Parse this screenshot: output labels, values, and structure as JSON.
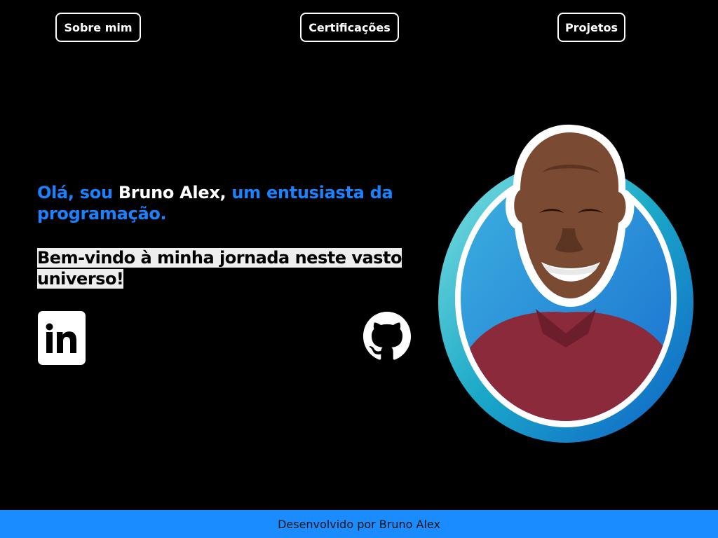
{
  "nav": {
    "about_label": "Sobre mim",
    "certs_label": "Certificações",
    "projects_label": "Projetos"
  },
  "hero": {
    "greeting_prefix": "Olá, sou ",
    "name": "Bruno Alex,",
    "greeting_suffix": " um entusiasta da programação.",
    "welcome": "Bem-vindo à minha jornada neste vasto universo!"
  },
  "social": {
    "linkedin_icon": "linkedin-icon",
    "github_icon": "github-icon"
  },
  "footer": {
    "text": "Desenvolvido por Bruno Alex"
  },
  "colors": {
    "background": "#000000",
    "accent": "#1a82ff",
    "footer": "#1a8cff",
    "text": "#ffffff"
  }
}
